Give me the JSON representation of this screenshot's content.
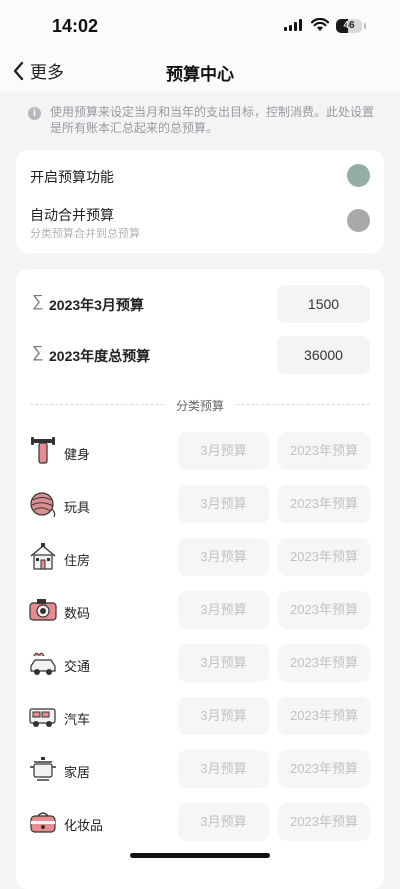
{
  "status": {
    "time": "14:02",
    "battery": "46"
  },
  "nav": {
    "back_label": "更多",
    "title": "预算中心"
  },
  "notice": {
    "text": "使用预算来设定当月和当年的支出目标，控制消费。此处设置是所有账本汇总起来的总预算。"
  },
  "settings": {
    "enable_label": "开启预算功能",
    "merge_label": "自动合并预算",
    "merge_sub": "分类预算合并到总预算"
  },
  "colors": {
    "enable_toggle": "#94aea3",
    "merge_toggle": "#a9a9a9"
  },
  "budgets": {
    "month_label": "2023年3月预算",
    "month_value": "1500",
    "year_label": "2023年度总预算",
    "year_value": "36000"
  },
  "category_section": {
    "title": "分类预算"
  },
  "categories": [
    {
      "name": "健身",
      "icon": "dumbbell-icon",
      "month_placeholder": "3月预算",
      "year_placeholder": "2023年预算"
    },
    {
      "name": "玩具",
      "icon": "yarn-ball-icon",
      "month_placeholder": "3月预算",
      "year_placeholder": "2023年预算"
    },
    {
      "name": "住房",
      "icon": "house-icon",
      "month_placeholder": "3月预算",
      "year_placeholder": "2023年预算"
    },
    {
      "name": "数码",
      "icon": "camera-icon",
      "month_placeholder": "3月预算",
      "year_placeholder": "2023年预算"
    },
    {
      "name": "交通",
      "icon": "car-icon",
      "month_placeholder": "3月预算",
      "year_placeholder": "2023年预算"
    },
    {
      "name": "汽车",
      "icon": "van-icon",
      "month_placeholder": "3月预算",
      "year_placeholder": "2023年预算"
    },
    {
      "name": "家居",
      "icon": "pot-icon",
      "month_placeholder": "3月预算",
      "year_placeholder": "2023年预算"
    },
    {
      "name": "化妆品",
      "icon": "cosmetic-case-icon",
      "month_placeholder": "3月预算",
      "year_placeholder": "2023年预算"
    }
  ]
}
